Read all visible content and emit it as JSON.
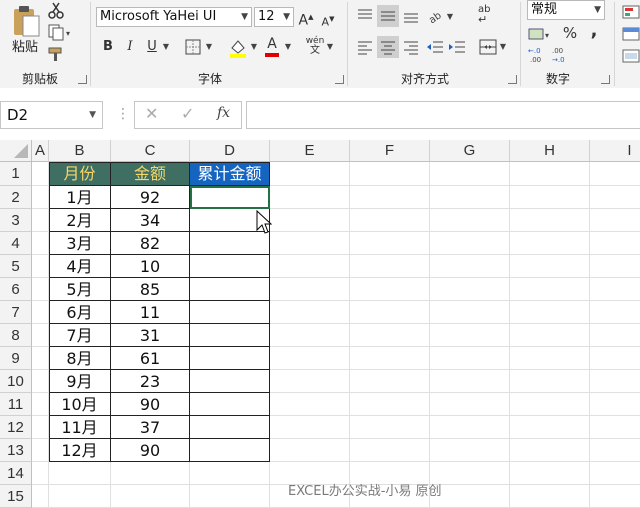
{
  "ribbon": {
    "clipboard": {
      "paste_label": "粘贴",
      "group_label": "剪贴板"
    },
    "font": {
      "family": "Microsoft YaHei UI",
      "size": "12",
      "bold": "B",
      "italic": "I",
      "underline": "U",
      "grow": "A",
      "shrink": "A",
      "color_a": "A",
      "phonetic": "wén",
      "group_label": "字体"
    },
    "alignment": {
      "wrap": "ab",
      "group_label": "对齐方式"
    },
    "number": {
      "format": "常规",
      "percent": "%",
      "comma": ",",
      "group_label": "数字"
    }
  },
  "formula_bar": {
    "name_box": "D2",
    "fx": "fx",
    "formula": ""
  },
  "columns": [
    "A",
    "B",
    "C",
    "D",
    "E",
    "F",
    "G",
    "H",
    "I"
  ],
  "rows": [
    "1",
    "2",
    "3",
    "4",
    "5",
    "6",
    "7",
    "8",
    "9",
    "10",
    "11",
    "12",
    "13",
    "14",
    "15"
  ],
  "table": {
    "headers": [
      "月份",
      "金额",
      "累计金额"
    ],
    "rows": [
      [
        "1月",
        "92",
        ""
      ],
      [
        "2月",
        "34",
        ""
      ],
      [
        "3月",
        "82",
        ""
      ],
      [
        "4月",
        "10",
        ""
      ],
      [
        "5月",
        "85",
        ""
      ],
      [
        "6月",
        "11",
        ""
      ],
      [
        "7月",
        "31",
        ""
      ],
      [
        "8月",
        "61",
        ""
      ],
      [
        "9月",
        "23",
        ""
      ],
      [
        "10月",
        "90",
        ""
      ],
      [
        "11月",
        "37",
        ""
      ],
      [
        "12月",
        "90",
        ""
      ]
    ]
  },
  "watermark": "EXCEL办公实战-小易 原创",
  "colors": {
    "header_green": "#3f6f63",
    "header_text_yellow": "#f5d66a",
    "header_blue": "#1565c0"
  }
}
